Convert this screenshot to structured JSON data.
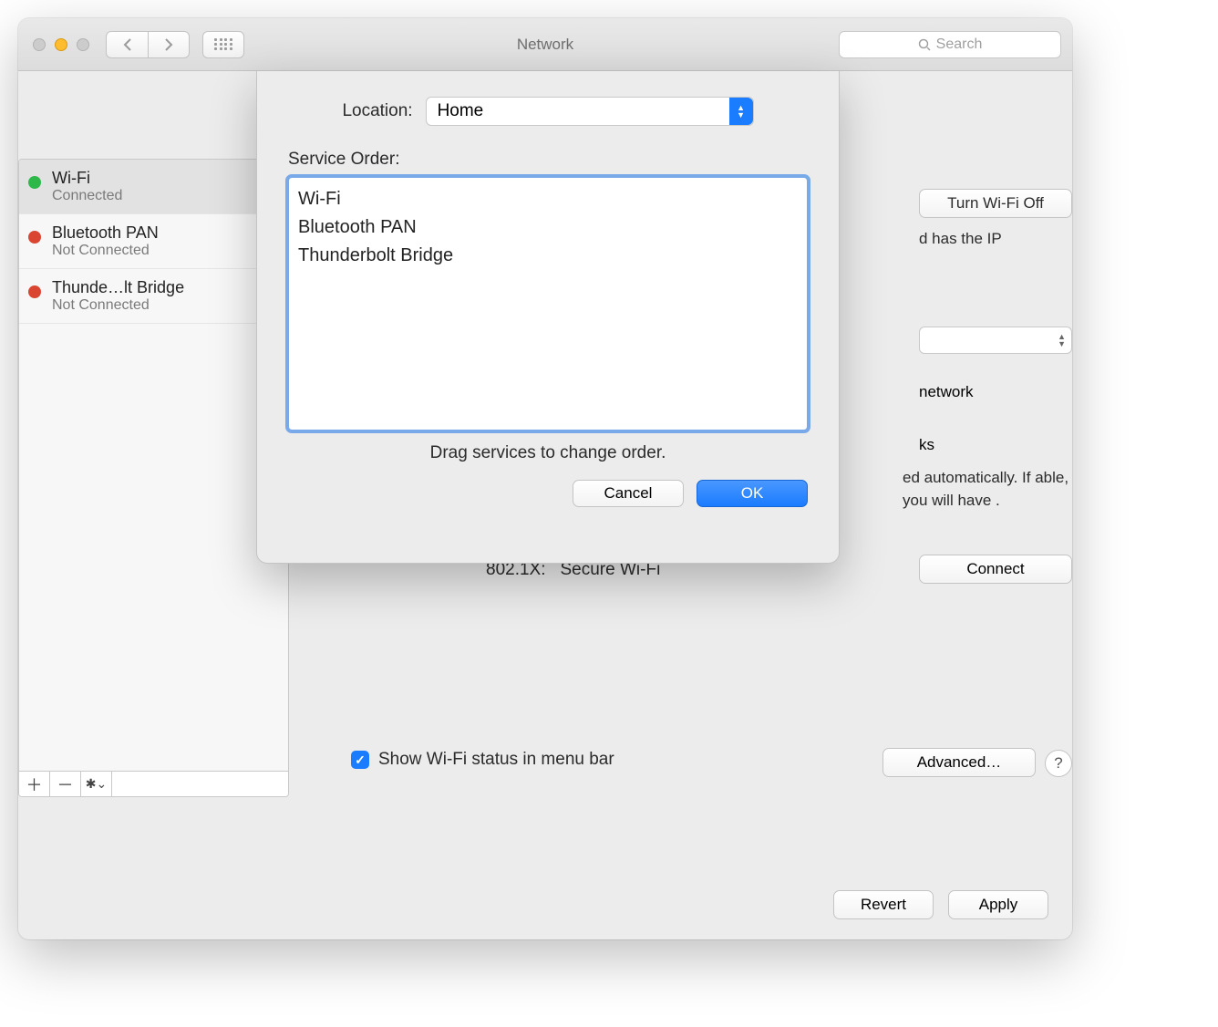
{
  "window": {
    "title": "Network",
    "search_placeholder": "Search"
  },
  "sidebar": {
    "services": [
      {
        "name": "Wi-Fi",
        "status": "Connected",
        "color": "green",
        "selected": true
      },
      {
        "name": "Bluetooth PAN",
        "status": "Not Connected",
        "color": "red",
        "selected": false
      },
      {
        "name": "Thunde…lt Bridge",
        "status": "Not Connected",
        "color": "red",
        "selected": false
      }
    ]
  },
  "detail": {
    "wifi_off_label": "Turn Wi-Fi Off",
    "ip_fragment": "d has the IP",
    "net_fragment_1": "network",
    "net_fragment_2": "ks",
    "autojoin_text": "ed automatically. If able, you will have .",
    "auth_label": "802.1X:",
    "auth_value": "Secure Wi-Fi",
    "connect_label": "Connect",
    "menubar_label": "Show Wi-Fi status in menu bar",
    "menubar_checked": true,
    "advanced_label": "Advanced…",
    "help_label": "?"
  },
  "footer": {
    "revert_label": "Revert",
    "apply_label": "Apply"
  },
  "sheet": {
    "location_label": "Location:",
    "location_value": "Home",
    "service_order_label": "Service Order:",
    "items": [
      "Wi-Fi",
      "Bluetooth PAN",
      "Thunderbolt Bridge"
    ],
    "drag_hint": "Drag services to change order.",
    "cancel_label": "Cancel",
    "ok_label": "OK"
  }
}
